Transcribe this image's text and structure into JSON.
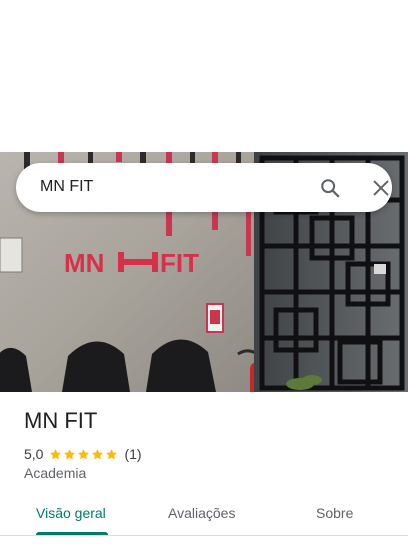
{
  "photo": {
    "sign_left": "MN",
    "sign_right": "FIT"
  },
  "search": {
    "query": "MN FIT",
    "search_icon": "search-icon",
    "close_icon": "close-icon"
  },
  "place": {
    "name": "MN FIT",
    "rating_text": "5,0",
    "rating_value": 5,
    "rating_max": 5,
    "review_count": "(1)",
    "category": "Academia"
  },
  "tabs": [
    {
      "label": "Visão geral",
      "active": true
    },
    {
      "label": "Avaliações",
      "active": false
    },
    {
      "label": "Sobre",
      "active": false
    }
  ],
  "colors": {
    "accent": "#00796b",
    "star": "#fbbc04",
    "sign_red": "#d6304a"
  }
}
